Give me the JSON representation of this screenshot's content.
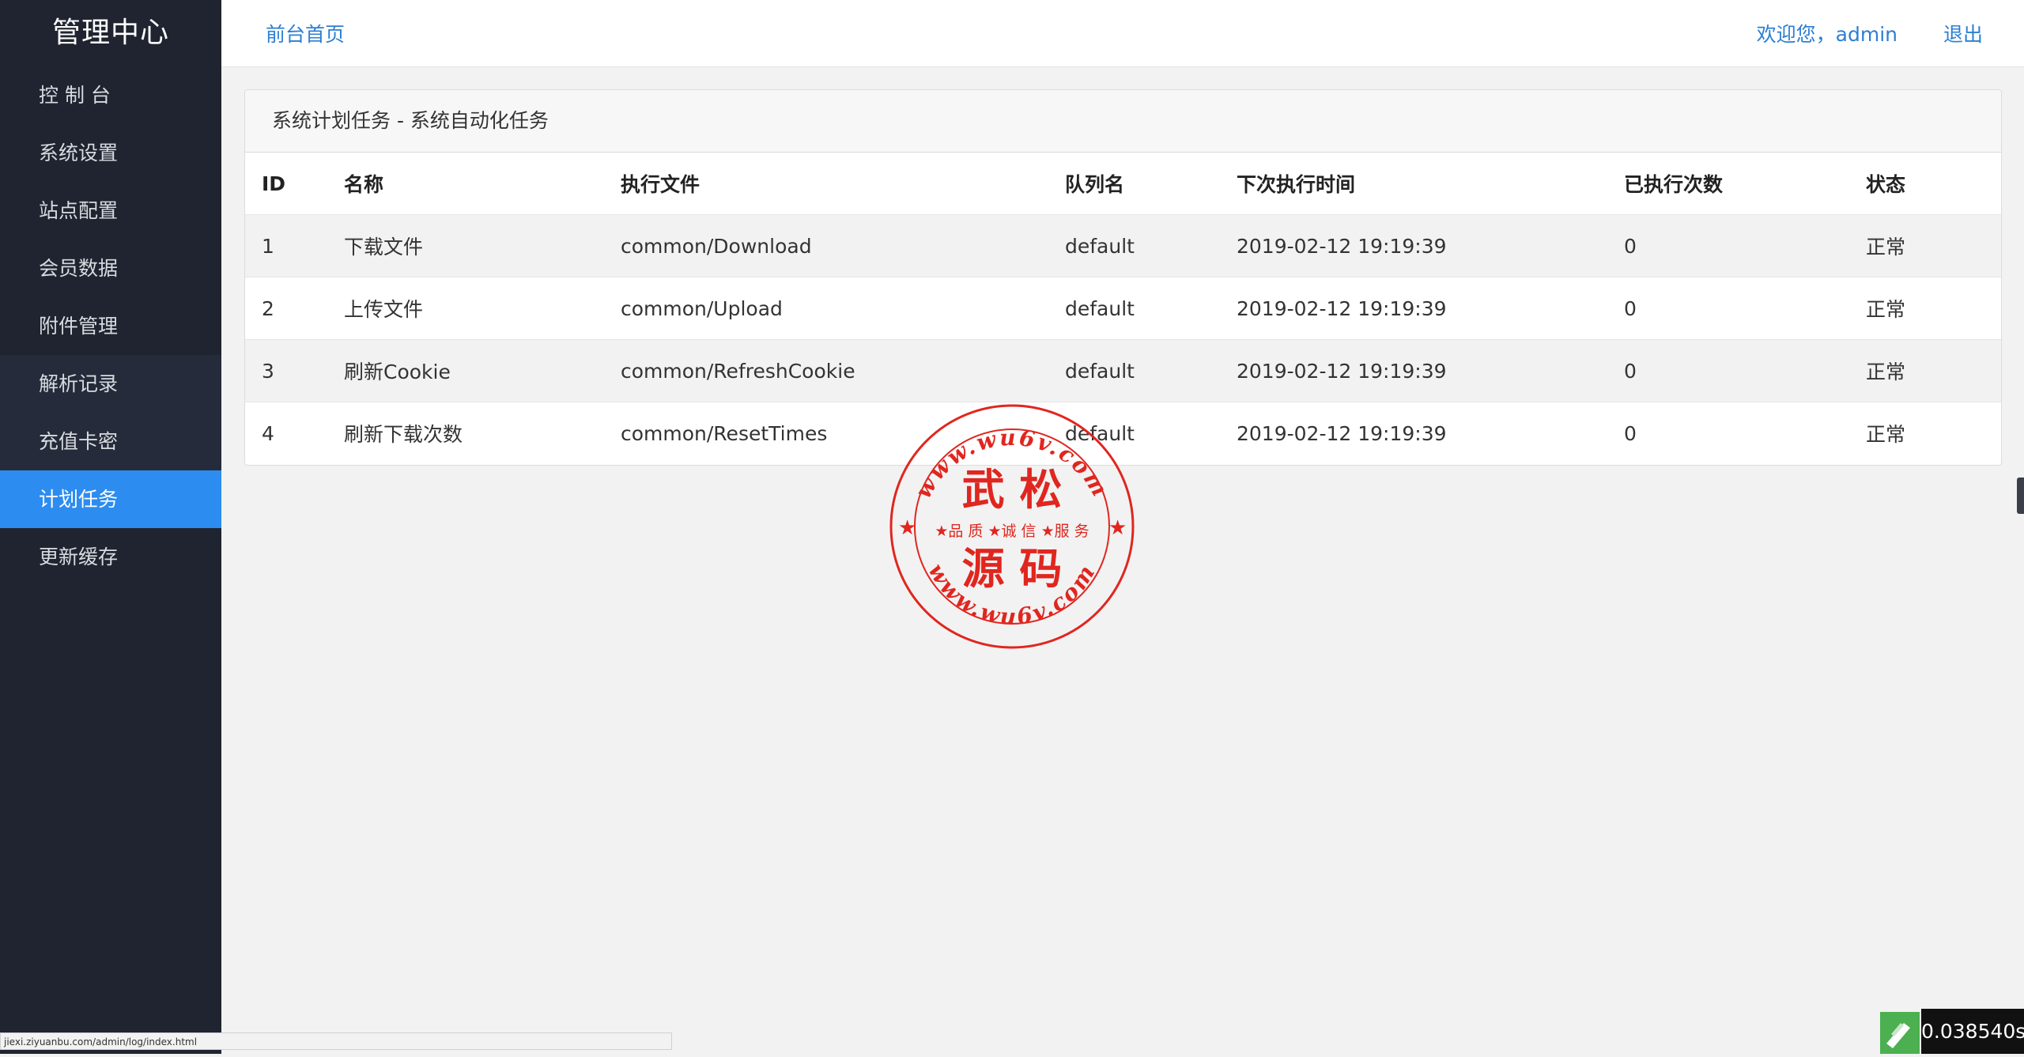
{
  "sidebar": {
    "brand": "管理中心",
    "items": [
      {
        "label": "控 制 台"
      },
      {
        "label": "系统设置"
      },
      {
        "label": "站点配置"
      },
      {
        "label": "会员数据"
      },
      {
        "label": "附件管理"
      },
      {
        "label": "解析记录"
      },
      {
        "label": "充值卡密"
      },
      {
        "label": "计划任务"
      },
      {
        "label": "更新缓存"
      }
    ]
  },
  "header": {
    "home_link": "前台首页",
    "welcome": "欢迎您，admin",
    "logout": "退出"
  },
  "panel": {
    "title": "系统计划任务 - 系统自动化任务",
    "columns": [
      "ID",
      "名称",
      "执行文件",
      "队列名",
      "下次执行时间",
      "已执行次数",
      "状态"
    ],
    "rows": [
      [
        "1",
        "下载文件",
        "common/Download",
        "default",
        "2019-02-12 19:19:39",
        "0",
        "正常"
      ],
      [
        "2",
        "上传文件",
        "common/Upload",
        "default",
        "2019-02-12 19:19:39",
        "0",
        "正常"
      ],
      [
        "3",
        "刷新Cookie",
        "common/RefreshCookie",
        "default",
        "2019-02-12 19:19:39",
        "0",
        "正常"
      ],
      [
        "4",
        "刷新下载次数",
        "common/ResetTimes",
        "default",
        "2019-02-12 19:19:39",
        "0",
        "正常"
      ]
    ]
  },
  "watermark": {
    "top_text": "www.wu6v.com",
    "line1": "武 松",
    "middle": "★品 质 ★诚 信 ★服 务",
    "line2": "源 码",
    "bottom_text": "www.wu6v.com",
    "color": "#e0261f"
  },
  "statusbar": {
    "url": "jiexi.ziyuanbu.com/admin/log/index.html"
  },
  "timer": {
    "value": "0.038540s"
  },
  "colors": {
    "sidebar_bg": "#1f2430",
    "accent": "#2d8cf0",
    "link": "#2d7fd2"
  }
}
